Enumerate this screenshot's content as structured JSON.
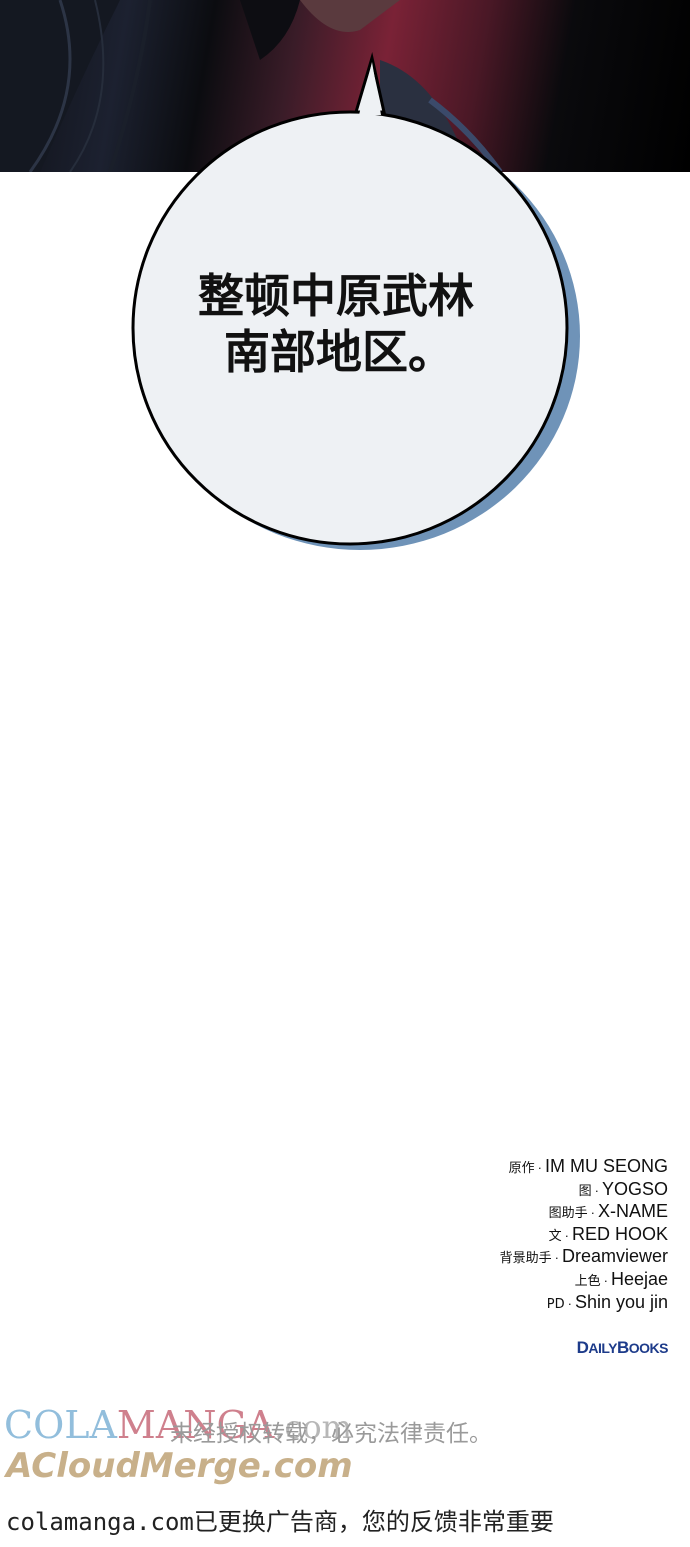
{
  "panel": {
    "bubble_lines": [
      "整顿中原武林",
      "南部地区。"
    ]
  },
  "credits": [
    {
      "role": "原作",
      "name": "IM MU SEONG"
    },
    {
      "role": "图",
      "name": "YOGSO"
    },
    {
      "role": "图助手",
      "name": "X-NAME"
    },
    {
      "role": "文",
      "name": "RED HOOK"
    },
    {
      "role": "背景助手",
      "name": "Dreamviewer"
    },
    {
      "role": "上色",
      "name": "Heejae"
    },
    {
      "role": "PD",
      "name": "Shin you jin"
    }
  ],
  "publisher": {
    "part1": "D",
    "part2": "AILY",
    "part3": "B",
    "part4": "OOKS"
  },
  "watermark": {
    "cola": "COLA",
    "manga": "MANGA",
    "com": ".com",
    "notice": "未经授权转载，必究法律责任。",
    "acloud": "ACloudMerge.com"
  },
  "footer": {
    "text": "colamanga.com已更换广告商，您的反馈非常重要"
  },
  "colors": {
    "bubble_fill": "#eef1f4",
    "bubble_shadow": "#6f93b8",
    "outline": "#000000"
  }
}
